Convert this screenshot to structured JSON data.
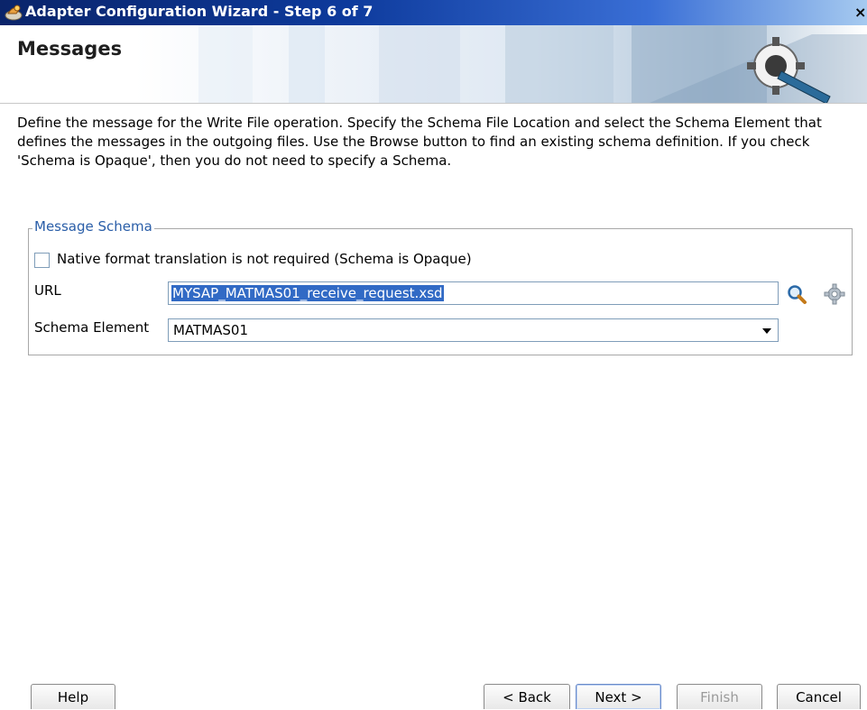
{
  "window": {
    "title": "Adapter Configuration Wizard - Step 6 of 7",
    "close_glyph": "×"
  },
  "header": {
    "page_title": "Messages"
  },
  "description": "Define the message for the Write File operation.  Specify the Schema File Location and select the Schema Element that defines the messages in the outgoing files. Use the Browse button to find an existing schema definition. If you check 'Schema is Opaque', then you do not need to specify a Schema.",
  "message_schema": {
    "legend": "Message Schema",
    "opaque_checkbox": {
      "label": "Native format translation is not required (Schema is Opaque)",
      "checked": false
    },
    "url": {
      "label": "URL",
      "value": "MYSAP_MATMAS01_receive_request.xsd"
    },
    "schema_element": {
      "label": "Schema Element",
      "selected": "MATMAS01"
    }
  },
  "footer": {
    "help_label": "Help",
    "back_label": "< Back",
    "next_label": "Next >",
    "finish_label": "Finish",
    "cancel_label": "Cancel"
  },
  "icons": {
    "title": "adapter-icon",
    "header": "gear-wizard-icon",
    "browse": "search-icon",
    "schema_wizard": "gear-icon",
    "dropdown": "chevron-down-icon"
  },
  "colors": {
    "title_bar": "#0a246a",
    "selection": "#316ac5",
    "legend": "#2a5ea8"
  }
}
